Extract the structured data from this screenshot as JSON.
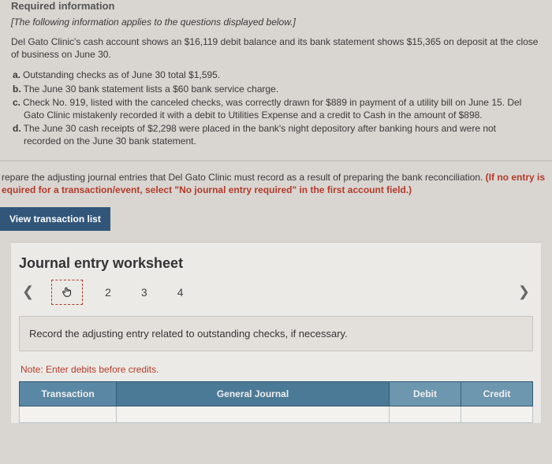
{
  "header": {
    "required": "Required information",
    "note": "[The following information applies to the questions displayed below.]",
    "scenario": "Del Gato Clinic's cash account shows an $16,119 debit balance and its bank statement shows $15,365 on deposit at the close of business on June 30."
  },
  "items": {
    "a": {
      "label": "a.",
      "text": "Outstanding checks as of June 30 total $1,595."
    },
    "b": {
      "label": "b.",
      "text": "The June 30 bank statement lists a $60 bank service charge."
    },
    "c": {
      "label": "c.",
      "text1": "Check No. 919, listed with the canceled checks, was correctly drawn for $889 in payment of a utility bill on June 15. Del",
      "text2": "Gato Clinic mistakenly recorded it with a debit to Utilities Expense and a credit to Cash in the amount of $898."
    },
    "d": {
      "label": "d.",
      "text1": "The June 30 cash receipts of $2,298 were placed in the bank's night depository after banking hours and were not",
      "text2": "recorded on the June 30 bank statement."
    }
  },
  "instruction": {
    "p1": "repare the adjusting journal entries that Del Gato Clinic must record as a result of preparing the bank reconciliation. ",
    "p2": "(If no entry is",
    "p3": "equired for a transaction/event, select \"No journal entry required\" in the first account field.)"
  },
  "tab": {
    "view": "View transaction list"
  },
  "worksheet": {
    "title": "Journal entry worksheet",
    "pages": {
      "p2": "2",
      "p3": "3",
      "p4": "4"
    },
    "prompt": "Record the adjusting entry related to outstanding checks, if necessary.",
    "note": "Note: Enter debits before credits.",
    "cols": {
      "trans": "Transaction",
      "gj": "General Journal",
      "debit": "Debit",
      "credit": "Credit"
    }
  }
}
